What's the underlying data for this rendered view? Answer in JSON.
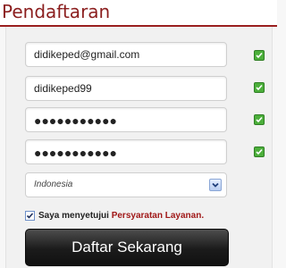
{
  "header": {
    "title": "Pendaftaran"
  },
  "form": {
    "email_value": "didikeped@gmail.com",
    "username_value": "didikeped99",
    "password_value": "●●●●●●●●●●●",
    "confirm_password_value": "●●●●●●●●●●●",
    "country_selected": "Indonesia",
    "terms_text": "Saya menyetujui",
    "terms_link": "Persyaratan Layanan.",
    "submit_label": "Daftar Sekarang"
  },
  "status_color": "#4caf3b",
  "icons": [
    "check-icon",
    "chevron-down-icon"
  ]
}
